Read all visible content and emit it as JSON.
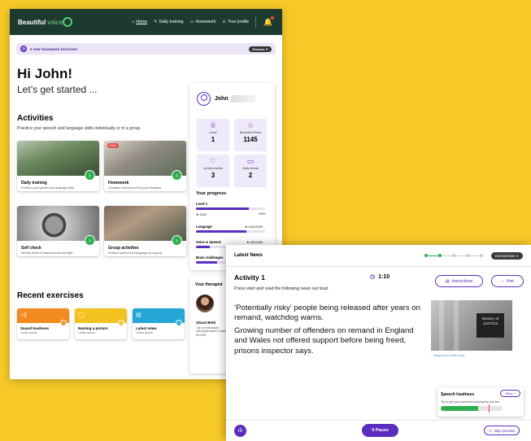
{
  "nav": {
    "logo_main": "Beautiful",
    "logo_accent": "voice",
    "links": [
      {
        "icon": "⌂",
        "label": "Home"
      },
      {
        "icon": "✎",
        "label": "Daily training"
      },
      {
        "icon": "▭",
        "label": "Homework"
      },
      {
        "icon": "♙",
        "label": "Your profile"
      }
    ]
  },
  "banner": {
    "text": "2 new homework exercises",
    "dismiss": "Dismiss ✕"
  },
  "greeting": {
    "title": "Hi John!",
    "subtitle": "Let’s get started ..."
  },
  "activities": {
    "title": "Activities",
    "subtitle": "Practice your speech and language skills individually or in a group.",
    "new_tag": "New",
    "cards": [
      {
        "title": "Daily training",
        "desc": "Practice your speech and language skills"
      },
      {
        "title": "Homework",
        "desc": "Complete exercises set by your therapist"
      },
      {
        "title": "Self check",
        "desc": "Identify areas of weakness and strength"
      },
      {
        "title": "Group activities",
        "desc": "Practice speech and language as a group"
      }
    ]
  },
  "recent": {
    "title": "Recent exercises",
    "items": [
      {
        "title": "Sound loudness",
        "desc": "Lorem ipsum",
        "color": "#f28a1f"
      },
      {
        "title": "Naming a picture",
        "desc": "Lorem ipsum",
        "color": "#f2c21f"
      },
      {
        "title": "Latest news",
        "desc": "Lorem ipsum",
        "color": "#24a6d6"
      }
    ]
  },
  "profile": {
    "name": "John",
    "stats": [
      {
        "label": "Level",
        "value": "1"
      },
      {
        "label": "Beautiful Points",
        "value": "1145"
      },
      {
        "label": "Achievements",
        "value": "3"
      },
      {
        "label": "Daily streak",
        "value": "2"
      }
    ],
    "progress_title": "Your progress",
    "level_label": "Level 1",
    "level_points": "★ 1145",
    "level_max": "1500",
    "level_fill": 0.76,
    "categories": [
      {
        "label": "Language",
        "info": "★ 1100/1500",
        "fill": 0.73
      },
      {
        "label": "Voice & Speech",
        "info": "★ 300/1500",
        "fill": 0.2
      },
      {
        "label": "Brain challenges",
        "info": "",
        "fill": 0.3
      }
    ]
  },
  "therapist": {
    "title": "Your therapist",
    "about_title": "About Beth",
    "about_text": "I am an enthusiastic pathologist based in career in the NHS..."
  },
  "activity": {
    "window_title": "Latest News",
    "end_exercise": "End exercise ✕",
    "title": "Activity 1",
    "timer": "1:10",
    "instruction": "Press start and read the following news out loud.",
    "instructions_button": "Instructions",
    "hint_button": "Hint",
    "news": [
      "‘Potentially risky’ people being released after years on remand, watchdog warns.",
      "Growing number of offenders on remand in England and Wales not offered support before being freed, prisons inspector says."
    ],
    "image_sign": "Ministry of JUSTICE",
    "read_more": "—Read more of this news",
    "loudness": {
      "title": "Speech loudness",
      "more": "More +",
      "desc": "Try to get your loudness touching the red line.",
      "level": 0.6
    },
    "pause": "II Pause",
    "skip": "Skip Question"
  },
  "colors": {
    "accent": "#5b2ebf",
    "green": "#2fae4f",
    "nav": "#1d3a31",
    "background": "#f7c928"
  }
}
